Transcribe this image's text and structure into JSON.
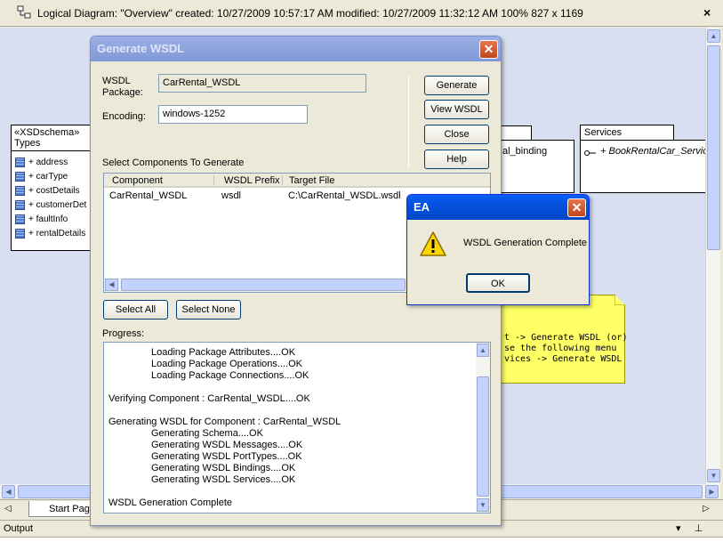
{
  "infobar": {
    "text": "Logical Diagram: \"Overview\"   created: 10/27/2009 10:57:17 AM   modified: 10/27/2009 11:32:12 AM   100%   827 x 1169",
    "close_glyph": "×"
  },
  "diagram": {
    "types_box": {
      "stereotype": "«XSDschema»",
      "name": "Types",
      "attributes": [
        "+ address",
        "+ carType",
        "+ costDetails",
        "+ customerDet",
        "+ faultInfo",
        "+ rentalDetails"
      ]
    },
    "binding_label": "al_binding",
    "services_tab": "Services",
    "services_item": "+ BookRentalCar_Servic",
    "note_lines": [
      "t -> Generate WSDL (or)",
      "",
      "se the following menu",
      "vices -> Generate WSDL"
    ]
  },
  "tabbar": {
    "start_tab": "Start Pag",
    "left_arrow": "◁",
    "right_arrow": "▷"
  },
  "output": {
    "title": "Output",
    "controls": "▾ ⊥ ×"
  },
  "generate_dialog": {
    "title": "Generate WSDL",
    "wsdl_package_label": "WSDL\nPackage:",
    "wsdl_package_value": "CarRental_WSDL",
    "encoding_label": "Encoding:",
    "encoding_value": "windows-1252",
    "buttons": {
      "generate": "Generate",
      "view": "View WSDL",
      "close": "Close",
      "help": "Help"
    },
    "select_label": "Select Components To Generate",
    "columns": [
      "Component",
      "WSDL Prefix",
      "Target File"
    ],
    "rows": [
      {
        "component": "CarRental_WSDL",
        "prefix": "wsdl",
        "target": "C:\\CarRental_WSDL.wsdl"
      }
    ],
    "select_all": "Select All",
    "select_none": "Select None",
    "progress_label": "Progress:",
    "progress_lines": [
      {
        "text": "Loading Package Attributes....OK",
        "indent": true
      },
      {
        "text": "Loading Package Operations....OK",
        "indent": true
      },
      {
        "text": "Loading Package Connections....OK",
        "indent": true
      },
      {
        "text": "",
        "indent": false
      },
      {
        "text": "Verifying Component : CarRental_WSDL....OK",
        "indent": false
      },
      {
        "text": "",
        "indent": false
      },
      {
        "text": "Generating WSDL for Component : CarRental_WSDL",
        "indent": false
      },
      {
        "text": "Generating Schema....OK",
        "indent": true
      },
      {
        "text": "Generating WSDL Messages....OK",
        "indent": true
      },
      {
        "text": "Generating WSDL PortTypes....OK",
        "indent": true
      },
      {
        "text": "Generating WSDL Bindings....OK",
        "indent": true
      },
      {
        "text": "Generating WSDL Services....OK",
        "indent": true
      },
      {
        "text": "",
        "indent": false
      },
      {
        "text": "WSDL Generation Complete",
        "indent": false
      }
    ]
  },
  "ea_dialog": {
    "title": "EA",
    "message": "WSDL Generation Complete",
    "ok": "OK",
    "icon": "warning-icon"
  },
  "colors": {
    "titlebar_active": "#0551dd",
    "note_yellow": "#ffff66",
    "canvas": "#d7dff1"
  }
}
